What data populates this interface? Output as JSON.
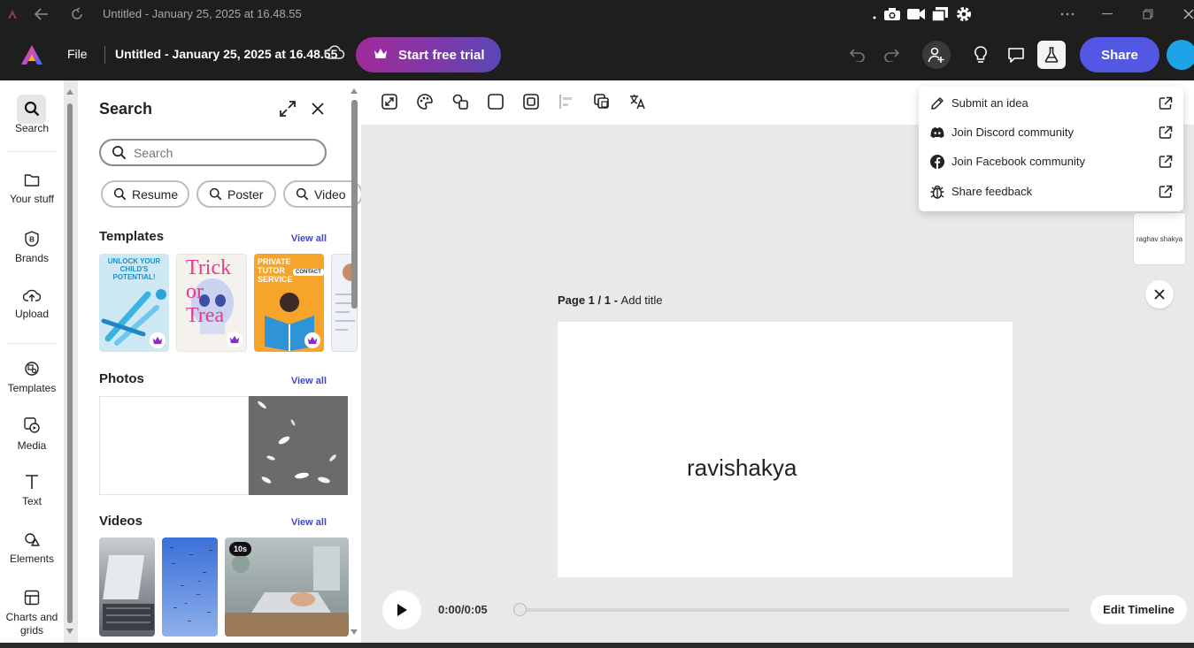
{
  "window": {
    "title": "Untitled - January 25, 2025 at 16.48.55"
  },
  "header": {
    "file_label": "File",
    "doc_title": "Untitled - January 25, 2025 at 16.48.55",
    "trial_label": "Start free trial",
    "share_label": "Share",
    "accent_color": "#5258e4"
  },
  "rail": {
    "items": [
      {
        "label": "Search",
        "icon": "search-icon"
      },
      {
        "label": "Your stuff",
        "icon": "folder-icon"
      },
      {
        "label": "Brands",
        "icon": "brand-icon"
      },
      {
        "label": "Upload",
        "icon": "upload-icon"
      },
      {
        "label": "Templates",
        "icon": "templates-icon"
      },
      {
        "label": "Media",
        "icon": "media-icon"
      },
      {
        "label": "Text",
        "icon": "text-icon"
      },
      {
        "label": "Elements",
        "icon": "elements-icon"
      },
      {
        "label": "Charts and grids",
        "icon": "charts-icon"
      }
    ]
  },
  "panel": {
    "title": "Search",
    "search_placeholder": "Search",
    "chips": [
      "Resume",
      "Poster",
      "Video"
    ],
    "templates_title": "Templates",
    "photos_title": "Photos",
    "videos_title": "Videos",
    "view_all": "View all",
    "template_cards": [
      {
        "text": "UNLOCK YOUR CHILD'S POTENTIAL!"
      },
      {
        "text": "Trick or Trea"
      },
      {
        "text": "PRIVATE TUTOR SERVICE",
        "sub": "CONTACT"
      }
    ],
    "video_badge": "10s"
  },
  "canvas": {
    "page_label": "Page 1 / 1 - ",
    "add_title": "Add title",
    "page_text": "ravishakya",
    "side_card_text": "raghav shakya"
  },
  "player": {
    "time": "0:00/0:05",
    "progress": 0,
    "edit_timeline": "Edit Timeline"
  },
  "dropdown": {
    "items": [
      {
        "label": "Submit an idea",
        "icon": "pencil-icon"
      },
      {
        "label": "Join Discord community",
        "icon": "discord-icon"
      },
      {
        "label": "Join Facebook community",
        "icon": "facebook-icon"
      },
      {
        "label": "Share feedback",
        "icon": "bug-icon"
      }
    ]
  }
}
